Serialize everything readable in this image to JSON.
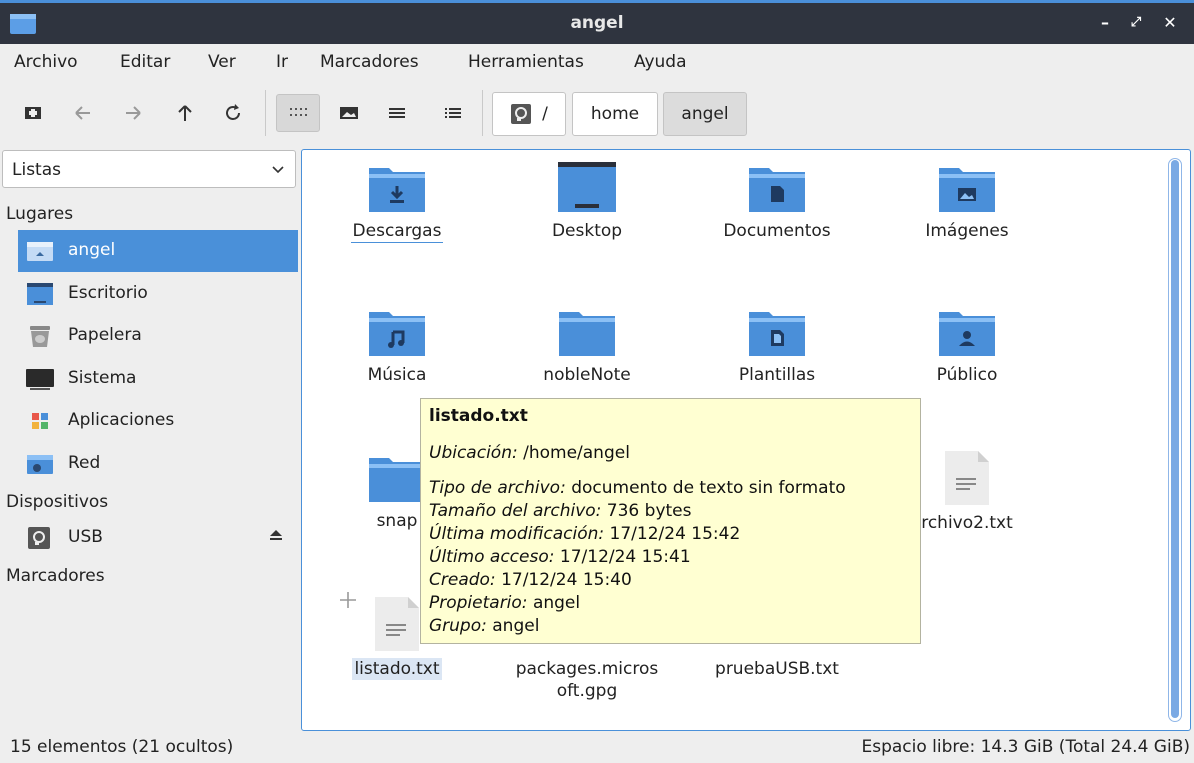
{
  "window": {
    "title": "angel"
  },
  "colors": {
    "accent": "#4a90d9",
    "titlebar": "#2f343f",
    "tooltip_bg": "#ffffd2",
    "folder": "#4a8fd9"
  },
  "menu": [
    "Archivo",
    "Editar",
    "Ver",
    "Ir",
    "Marcadores",
    "Herramientas",
    "Ayuda"
  ],
  "toolbar": {
    "icons": [
      "new-tab-icon",
      "back-arrow-icon",
      "forward-arrow-icon",
      "up-arrow-icon",
      "reload-icon",
      "icon-view-icon",
      "thumbnail-view-icon",
      "compact-view-icon",
      "detailed-list-icon"
    ],
    "active_view": "icon-view"
  },
  "breadcrumb": {
    "root": "/",
    "items": [
      "home",
      "angel"
    ]
  },
  "sidebar": {
    "mode": "Listas",
    "sections": {
      "places": "Lugares",
      "devices": "Dispositivos",
      "bookmarks": "Marcadores"
    },
    "places": [
      {
        "label": "angel",
        "icon": "home-folder-icon",
        "selected": true
      },
      {
        "label": "Escritorio",
        "icon": "desktop-icon"
      },
      {
        "label": "Papelera",
        "icon": "trash-icon"
      },
      {
        "label": "Sistema",
        "icon": "computer-icon"
      },
      {
        "label": "Aplicaciones",
        "icon": "applications-icon"
      },
      {
        "label": "Red",
        "icon": "network-icon"
      }
    ],
    "devices": [
      {
        "label": "USB",
        "icon": "usb-drive-icon"
      }
    ]
  },
  "files": [
    {
      "name": "Descargas",
      "type": "folder",
      "emblem": "download"
    },
    {
      "name": "Desktop",
      "type": "desktop"
    },
    {
      "name": "Documentos",
      "type": "folder",
      "emblem": "document"
    },
    {
      "name": "Imágenes",
      "type": "folder",
      "emblem": "image"
    },
    {
      "name": "Música",
      "type": "folder",
      "emblem": "music"
    },
    {
      "name": "nobleNote",
      "type": "folder"
    },
    {
      "name": "Plantillas",
      "type": "folder",
      "emblem": "template"
    },
    {
      "name": "Público",
      "type": "folder",
      "emblem": "public"
    },
    {
      "name": "snap",
      "type": "folder"
    },
    {
      "name": "archivo2.txt",
      "type": "text"
    },
    {
      "name": "listado.txt",
      "type": "text"
    },
    {
      "name": "packages.microsoft.gpg",
      "type": "text"
    },
    {
      "name": "pruebaUSB.txt",
      "type": "text"
    }
  ],
  "file_labels": {
    "snap_partial": "snap",
    "archivo2_partial": "rchivo2.txt",
    "packages_line1": "packages.micros",
    "packages_line2": "oft.gpg"
  },
  "tooltip": {
    "title": "listado.txt",
    "ubicacion_label": "Ubicación:",
    "ubicacion": "/home/angel",
    "tipo_label": "Tipo de archivo:",
    "tipo": "documento de texto sin formato",
    "tamano_label": "Tamaño del archivo:",
    "tamano": "736 bytes",
    "mod_label": "Última modificación:",
    "mod": "17/12/24 15:42",
    "acceso_label": "Último acceso:",
    "acceso": "17/12/24 15:41",
    "creado_label": "Creado:",
    "creado": "17/12/24 15:40",
    "prop_label": "Propietario:",
    "prop": "angel",
    "grupo_label": "Grupo:",
    "grupo": "angel"
  },
  "status": {
    "items": "15 elementos (21 ocultos)",
    "free_space": "Espacio libre: 14.3 GiB (Total 24.4 GiB)"
  }
}
